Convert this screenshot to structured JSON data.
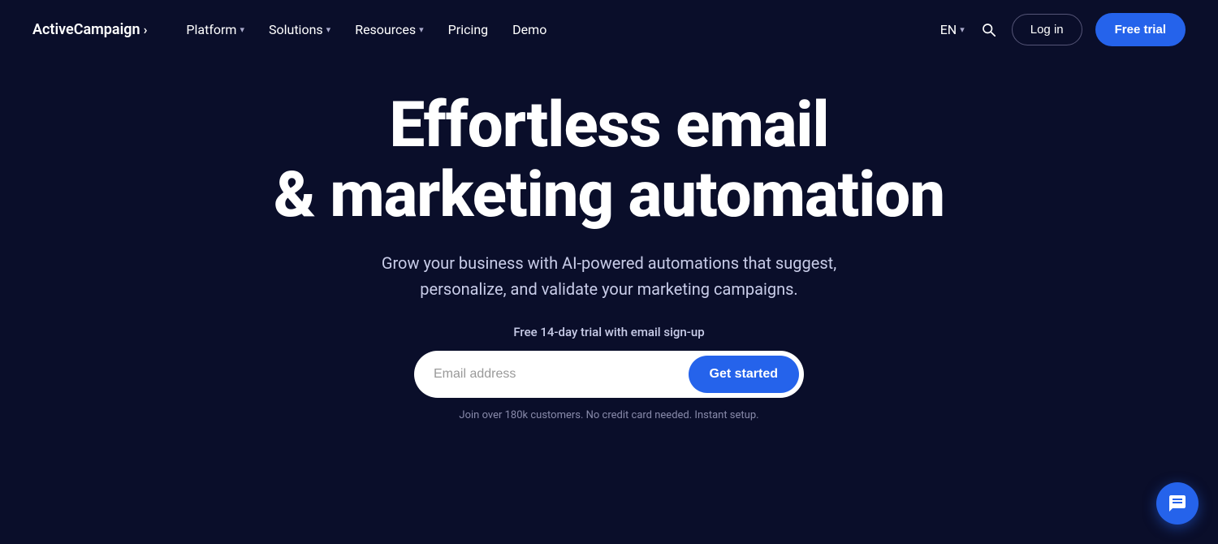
{
  "logo": {
    "text": "ActiveCampaign",
    "arrow": "›"
  },
  "nav": {
    "links": [
      {
        "label": "Platform",
        "hasDropdown": true
      },
      {
        "label": "Solutions",
        "hasDropdown": true
      },
      {
        "label": "Resources",
        "hasDropdown": true
      },
      {
        "label": "Pricing",
        "hasDropdown": false
      },
      {
        "label": "Demo",
        "hasDropdown": false
      }
    ],
    "language": "EN",
    "login_label": "Log in",
    "free_trial_label": "Free trial"
  },
  "hero": {
    "title_line1": "Effortless email",
    "title_line2": "& marketing automation",
    "subtitle": "Grow your business with AI-powered automations that suggest, personalize, and validate your marketing campaigns.",
    "trial_label": "Free 14-day trial with email sign-up",
    "email_placeholder": "Email address",
    "cta_label": "Get started",
    "fine_print": "Join over 180k customers. No credit card needed. Instant setup."
  }
}
